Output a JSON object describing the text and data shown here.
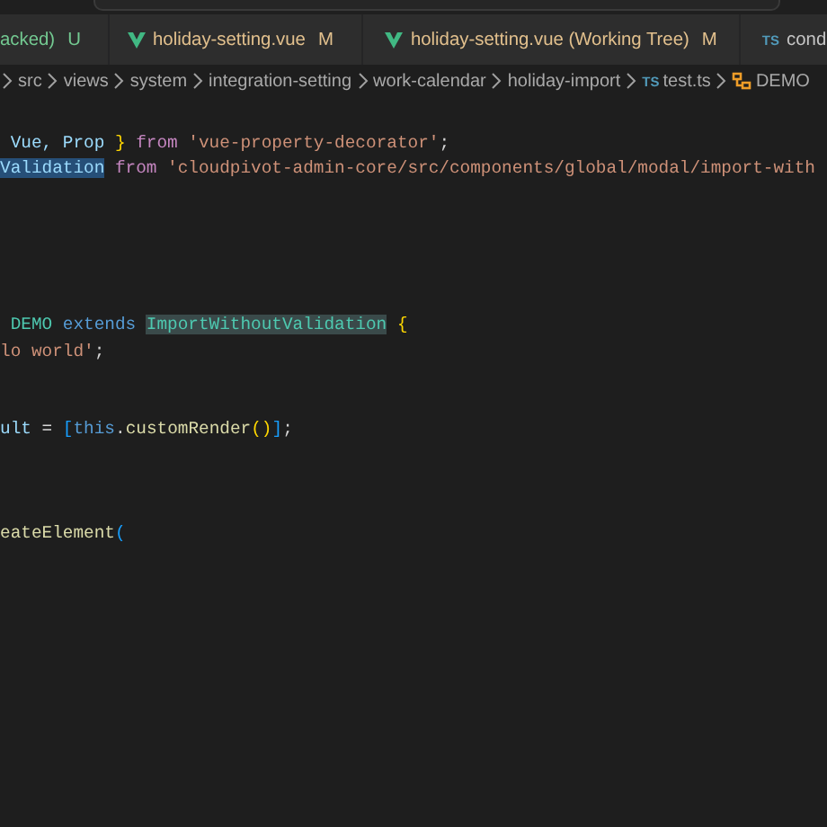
{
  "tabs": [
    {
      "kind": "plain",
      "label": "acked)",
      "badge": "U",
      "untracked": true,
      "modified": false
    },
    {
      "kind": "vue",
      "label": "holiday-setting.vue",
      "badge": "M",
      "untracked": false,
      "modified": true
    },
    {
      "kind": "vue",
      "label": "holiday-setting.vue (Working Tree)",
      "badge": "M",
      "untracked": false,
      "modified": true
    },
    {
      "kind": "ts",
      "icon_text": "TS",
      "label": "cond",
      "untracked": false,
      "modified": false
    }
  ],
  "breadcrumb": [
    {
      "kind": "folder",
      "label": "src"
    },
    {
      "kind": "folder",
      "label": "views"
    },
    {
      "kind": "folder",
      "label": "system"
    },
    {
      "kind": "folder",
      "label": "integration-setting"
    },
    {
      "kind": "folder",
      "label": "work-calendar"
    },
    {
      "kind": "folder",
      "label": "holiday-import"
    },
    {
      "kind": "ts",
      "icon_text": "TS",
      "label": "test.ts"
    },
    {
      "kind": "class",
      "label": "DEMO"
    }
  ],
  "code_lines": [
    {
      "kind": "blank"
    },
    {
      "kind": "code",
      "tokens": [
        {
          "text": " Vue, Prop ",
          "kind": "variable"
        },
        {
          "text": "}",
          "kind": "bracket"
        },
        {
          "text": " from ",
          "kind": "keyword"
        },
        {
          "text": "'vue-property-decorator'",
          "kind": "string"
        },
        {
          "text": ";",
          "kind": "plain"
        }
      ]
    },
    {
      "kind": "code",
      "tokens": [
        {
          "text": "Validation",
          "kind": "variable",
          "selected": true
        },
        {
          "text": " from ",
          "kind": "keyword"
        },
        {
          "text": "'cloudpivot-admin-core/src/components/global/modal/import-with",
          "kind": "string"
        }
      ]
    },
    {
      "kind": "blank"
    },
    {
      "kind": "blank"
    },
    {
      "kind": "blank"
    },
    {
      "kind": "blank"
    },
    {
      "kind": "blank"
    },
    {
      "kind": "code",
      "tokens": [
        {
          "text": " DEMO ",
          "kind": "class"
        },
        {
          "text": "extends ",
          "kind": "storage"
        },
        {
          "text": "ImportWithoutValidation",
          "kind": "class",
          "highlighted": true
        },
        {
          "text": " {",
          "kind": "bracket"
        }
      ]
    },
    {
      "kind": "code",
      "tokens": [
        {
          "text": "lo world'",
          "kind": "string"
        },
        {
          "text": ";",
          "kind": "plain"
        }
      ]
    },
    {
      "kind": "blank"
    },
    {
      "kind": "blank"
    },
    {
      "kind": "code",
      "tokens": [
        {
          "text": "ult ",
          "kind": "variable"
        },
        {
          "text": "= ",
          "kind": "plain"
        },
        {
          "text": "[",
          "kind": "bracket2"
        },
        {
          "text": "this",
          "kind": "storage"
        },
        {
          "text": ".",
          "kind": "plain"
        },
        {
          "text": "customRender",
          "kind": "function"
        },
        {
          "text": "()",
          "kind": "bracket"
        },
        {
          "text": "]",
          "kind": "bracket2"
        },
        {
          "text": ";",
          "kind": "plain"
        }
      ]
    },
    {
      "kind": "blank"
    },
    {
      "kind": "blank"
    },
    {
      "kind": "blank"
    },
    {
      "kind": "code",
      "tokens": [
        {
          "text": "eateElement",
          "kind": "function"
        },
        {
          "text": "(",
          "kind": "bracket2"
        }
      ]
    }
  ]
}
